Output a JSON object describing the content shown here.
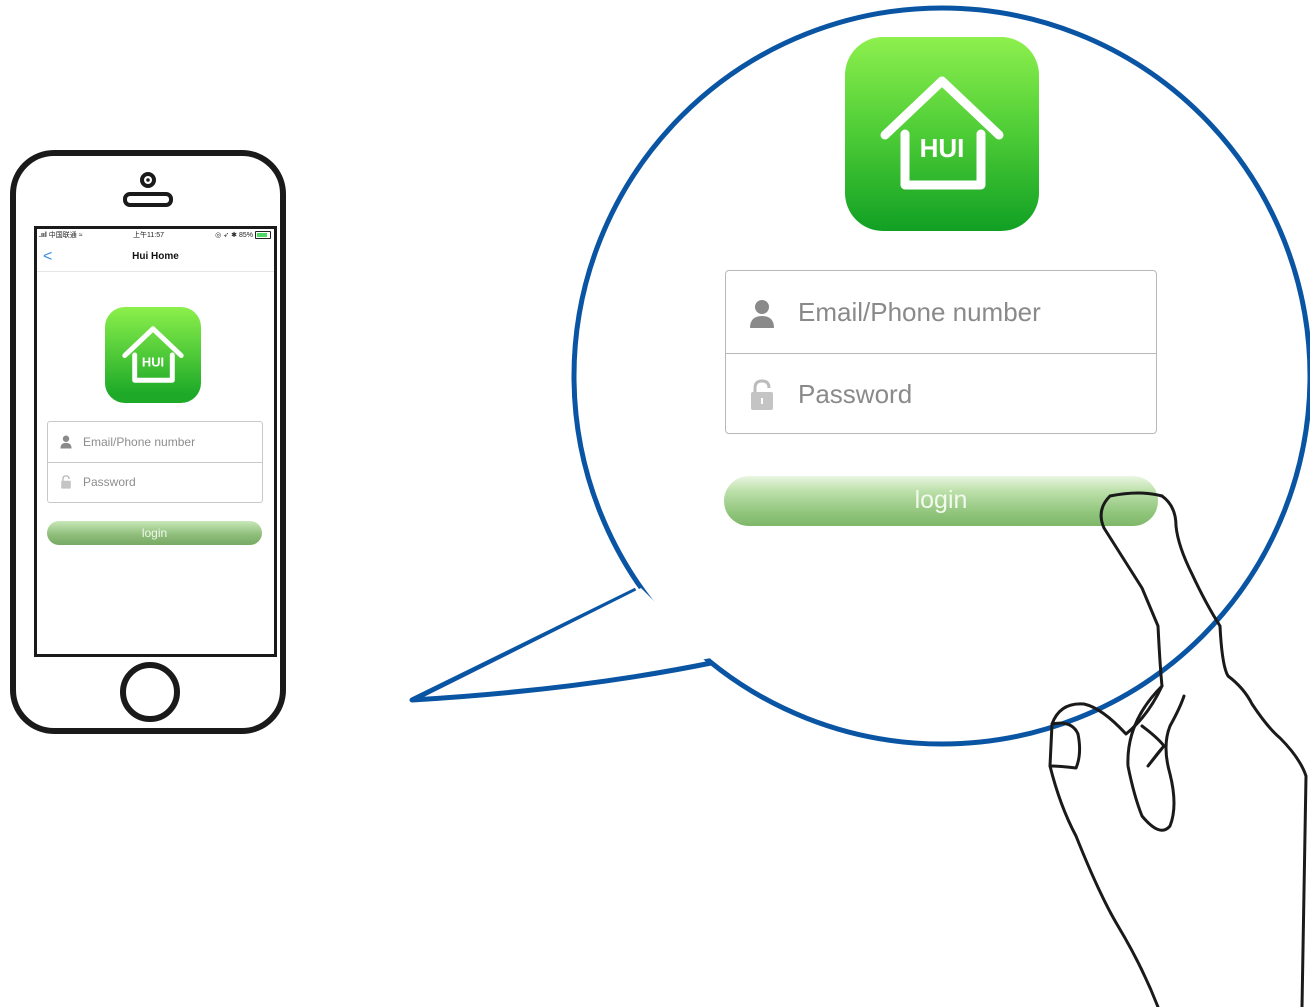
{
  "status_bar": {
    "carrier": "中国联通",
    "time": "上午11:57",
    "battery": "85%"
  },
  "nav": {
    "back": "<",
    "title": "Hui Home"
  },
  "app": {
    "icon_text": "HUI",
    "icon_name": "home-icon"
  },
  "login_form": {
    "email_placeholder": "Email/Phone number",
    "password_placeholder": "Password",
    "login_label": "login",
    "user_icon": "user-icon",
    "lock_icon": "lock-icon"
  },
  "colors": {
    "icon_green_top": "#8df04e",
    "icon_green_bottom": "#11a024",
    "bubble_blue": "#0a55a3",
    "button_green": "#8fc47a",
    "back_blue": "#3a8ee6"
  }
}
